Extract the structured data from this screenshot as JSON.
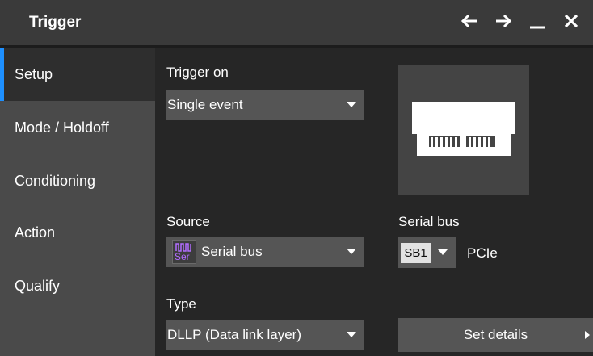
{
  "window": {
    "title": "Trigger"
  },
  "sidebar": {
    "items": [
      {
        "label": "Setup",
        "active": true
      },
      {
        "label": "Mode / Holdoff"
      },
      {
        "label": "Conditioning"
      },
      {
        "label": "Action"
      },
      {
        "label": "Qualify"
      }
    ]
  },
  "trigger_on": {
    "label": "Trigger on",
    "value": "Single event"
  },
  "source": {
    "label": "Source",
    "value": "Serial bus",
    "icon_text": "Ser"
  },
  "serial_bus": {
    "label": "Serial bus",
    "badge": "SB1",
    "protocol": "PCIe"
  },
  "type": {
    "label": "Type",
    "value": "DLLP (Data link layer)"
  },
  "set_details": {
    "label": "Set details"
  },
  "colors": {
    "accent": "#1e90ff",
    "source_icon": "#b26cff"
  }
}
